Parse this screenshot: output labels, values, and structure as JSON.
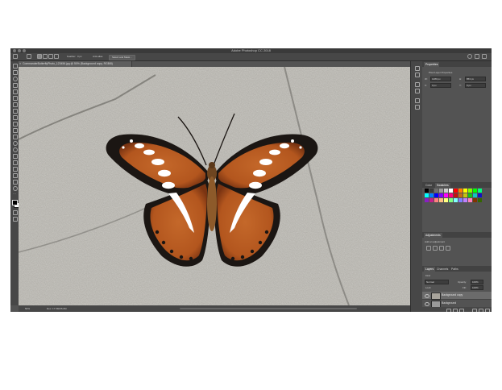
{
  "window": {
    "title": "Adobe Photoshop CC 2018"
  },
  "options_bar": {
    "home_icon": "home-icon",
    "tool_icon": "move-tool-icon",
    "feather_label": "Feather:",
    "feather_value": "0 px",
    "antialias_label": "Anti-alias",
    "select_mask_label": "Select and Mask..."
  },
  "document": {
    "tab_label": "CommanderButterflyPhoto_123456.jpg @ 50% (Background copy, RGB/8)",
    "zoom": "50%",
    "doc_size": "Doc: 17.5M/35.0M"
  },
  "canvas": {
    "subject": "butterfly",
    "colors": {
      "stone": "#b5b3ad",
      "wing_orange": "#b3561e",
      "wing_dark": "#1b1613",
      "band_white": "#ffffff",
      "body": "#8d5a2a"
    }
  },
  "panels": {
    "properties": {
      "tab": "Properties",
      "section": "Pixel Layer Properties",
      "w_label": "W:",
      "w_value": "1280 px",
      "h_label": "H:",
      "h_value": "853 px",
      "x_label": "X:",
      "x_value": "0 px",
      "y_label": "Y:",
      "y_value": "0 px"
    },
    "swatches_group": {
      "tabs": [
        "Color",
        "Swatches"
      ],
      "active": "Swatches",
      "colors": [
        "#000000",
        "#3a3a3a",
        "#6e6e6e",
        "#9e9e9e",
        "#cfcfcf",
        "#ffffff",
        "#ff0000",
        "#ff7f00",
        "#ffff00",
        "#7fff00",
        "#00ff00",
        "#00ff7f",
        "#00ffff",
        "#007fff",
        "#0000ff",
        "#7f00ff",
        "#ff00ff",
        "#ff007f",
        "#c41212",
        "#c46a12",
        "#c4c412",
        "#12c412",
        "#12c4c4",
        "#1212c4",
        "#8a1fc4",
        "#c41f8a",
        "#ff8080",
        "#ffbf80",
        "#ffff80",
        "#80ff80",
        "#80ffff",
        "#8080ff",
        "#bf80ff",
        "#ff80bf",
        "#803300",
        "#336600"
      ]
    },
    "adjustments": {
      "tab": "Adjustments",
      "hint": "Add an adjustment"
    },
    "layers": {
      "tabs": [
        "Layers",
        "Channels",
        "Paths"
      ],
      "active": "Layers",
      "kind_label": "Kind",
      "blend_mode": "Normal",
      "opacity_label": "Opacity:",
      "opacity_value": "100%",
      "lock_label": "Lock:",
      "fill_label": "Fill:",
      "fill_value": "100%",
      "items": [
        {
          "name": "Background copy",
          "selected": true
        },
        {
          "name": "Background",
          "selected": false
        }
      ]
    }
  },
  "tools": [
    "move-tool-icon",
    "marquee-tool-icon",
    "lasso-tool-icon",
    "quick-select-icon",
    "crop-tool-icon",
    "eyedropper-icon",
    "healing-brush-icon",
    "brush-icon",
    "clone-stamp-icon",
    "history-brush-icon",
    "eraser-icon",
    "gradient-icon",
    "blur-icon",
    "dodge-icon",
    "pen-icon",
    "type-tool-icon",
    "path-select-icon",
    "rectangle-tool-icon",
    "hand-tool-icon",
    "zoom-tool-icon",
    "edit-toolbar-icon"
  ]
}
